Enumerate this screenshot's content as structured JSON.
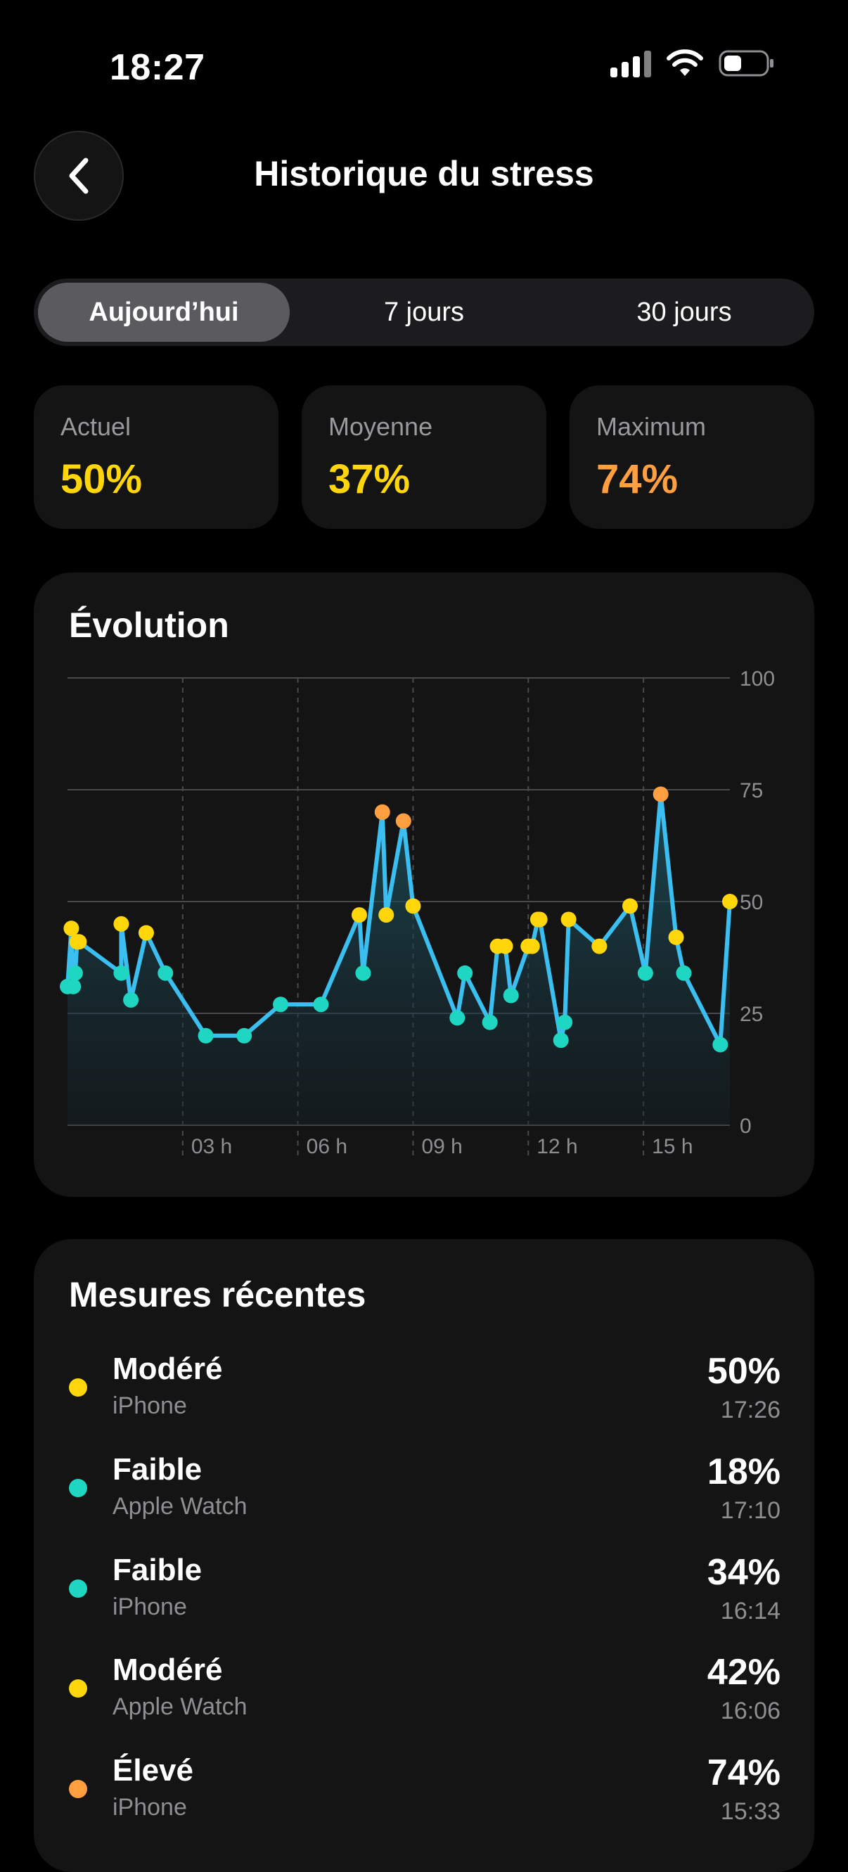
{
  "status_bar": {
    "time": "18:27"
  },
  "header": {
    "title": "Historique du stress"
  },
  "tabs": [
    {
      "label": "Aujourd’hui",
      "active": true
    },
    {
      "label": "7 jours",
      "active": false
    },
    {
      "label": "30 jours",
      "active": false
    }
  ],
  "stats": [
    {
      "label": "Actuel",
      "value": "50%",
      "color": "#FFD60A"
    },
    {
      "label": "Moyenne",
      "value": "37%",
      "color": "#FFD60A"
    },
    {
      "label": "Maximum",
      "value": "74%",
      "color": "#FF9F40"
    }
  ],
  "chart_section": {
    "title": "Évolution"
  },
  "chart_data": {
    "type": "line",
    "xlabel": "",
    "ylabel": "",
    "xlim": [
      0,
      17.25
    ],
    "ylim": [
      0,
      100
    ],
    "x_ticks": [
      3,
      6,
      9,
      12,
      15
    ],
    "x_tick_labels": [
      "03 h",
      "06 h",
      "09 h",
      "12 h",
      "15 h"
    ],
    "y_ticks": [
      0,
      25,
      50,
      75,
      100
    ],
    "y_tick_labels": [
      "0",
      "25",
      "50",
      "75",
      "100"
    ],
    "grid": true,
    "line_color": "#3ABFF0",
    "level_colors": {
      "faible": "#1ED6C1",
      "modere": "#FFD60A",
      "eleve": "#FF9F40"
    },
    "series": [
      {
        "x": [
          0.0,
          0.1,
          0.15,
          0.2,
          0.25,
          0.3,
          1.4,
          1.4,
          1.65,
          2.05,
          2.55,
          3.6,
          4.6,
          5.55,
          6.6,
          7.6,
          7.7,
          8.2,
          8.3,
          8.75,
          9.0,
          10.15,
          10.35,
          11.0,
          11.2,
          11.4,
          11.55,
          12.0,
          12.1,
          12.25,
          12.3,
          12.85,
          12.95,
          13.05,
          13.85,
          14.65,
          15.05,
          15.45,
          15.85,
          16.05,
          17.0,
          17.25
        ],
        "y": [
          31,
          44,
          31,
          34,
          41,
          41,
          34,
          45,
          28,
          43,
          34,
          20,
          20,
          27,
          27,
          47,
          34,
          70,
          47,
          68,
          49,
          24,
          34,
          23,
          40,
          40,
          29,
          40,
          40,
          46,
          46,
          19,
          23,
          46,
          40,
          49,
          34,
          74,
          42,
          34,
          18,
          50
        ]
      }
    ]
  },
  "recent": {
    "title": "Mesures récentes",
    "items": [
      {
        "level": "Modéré",
        "source": "iPhone",
        "value": "50%",
        "time": "17:26",
        "color": "#FFD60A"
      },
      {
        "level": "Faible",
        "source": "Apple Watch",
        "value": "18%",
        "time": "17:10",
        "color": "#1ED6C1"
      },
      {
        "level": "Faible",
        "source": "iPhone",
        "value": "34%",
        "time": "16:14",
        "color": "#1ED6C1"
      },
      {
        "level": "Modéré",
        "source": "Apple Watch",
        "value": "42%",
        "time": "16:06",
        "color": "#FFD60A"
      },
      {
        "level": "Élevé",
        "source": "iPhone",
        "value": "74%",
        "time": "15:33",
        "color": "#FF9F40"
      }
    ]
  }
}
